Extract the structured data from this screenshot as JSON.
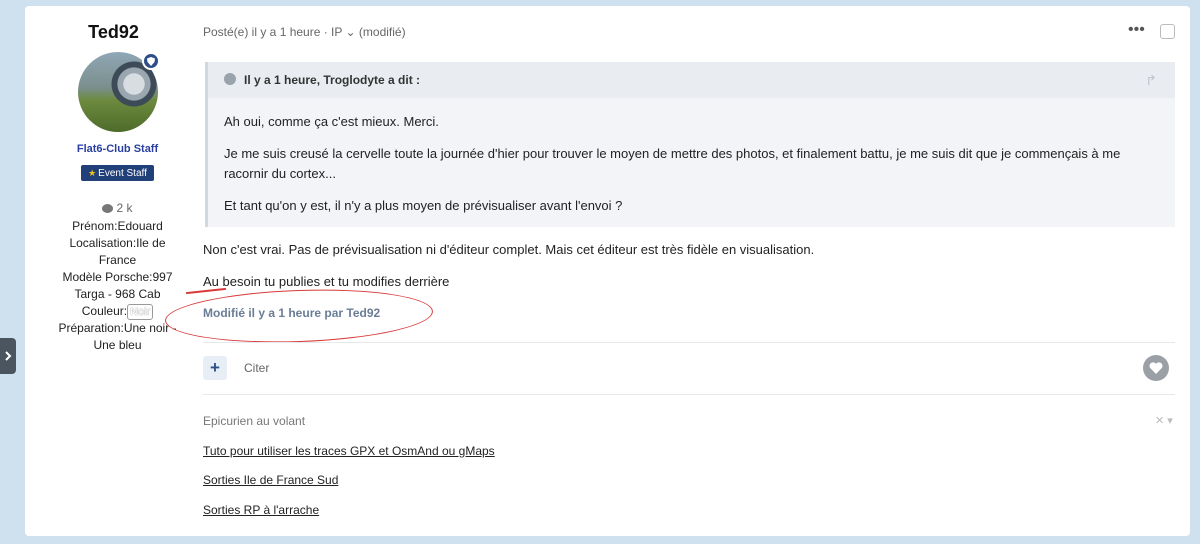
{
  "author": {
    "name": "Ted92",
    "group": "Flat6-Club Staff",
    "badge": "Event Staff",
    "posts": "2 k",
    "fields": [
      "Prénom:Edouard",
      "Localisation:Ile de",
      "France",
      "Modèle Porsche:997",
      "Targa - 968 Cab",
      "Couleur:",
      "Préparation:Une noir -",
      "Une bleu"
    ],
    "couleur_value": "Noir"
  },
  "post": {
    "meta": "Posté(e) il y a 1 heure · IP ⌄ (modifié)",
    "quote": {
      "title": "Il y a 1 heure, Troglodyte a dit :",
      "paragraphs": [
        "Ah oui, comme ça c'est mieux. Merci.",
        "Je me suis creusé la cervelle toute la journée d'hier pour trouver le moyen de mettre des photos, et finalement battu, je me suis dit que je commençais à me racornir du cortex...",
        "Et tant qu'on y est, il n'y a plus moyen de prévisualiser avant l'envoi ?"
      ]
    },
    "reply": [
      "Non c'est vrai. Pas de prévisualisation ni d'éditeur complet. Mais cet éditeur est très fidèle en visualisation.",
      "Au besoin tu publies et tu modifies derrière"
    ],
    "edited": "Modifié il y a 1 heure par Ted92",
    "actions": {
      "plus": "+",
      "cite": "Citer"
    }
  },
  "signature": {
    "title": "Epicurien au volant",
    "links": [
      "Tuto pour utiliser les traces GPX et OsmAnd ou gMaps",
      "Sorties Ile de France Sud",
      "Sorties RP à l'arrache"
    ]
  },
  "colors": {
    "background": "#cfe0ee",
    "group": "#2a3f9f",
    "badge": "#213f78",
    "annotation": "#d83a3a"
  }
}
